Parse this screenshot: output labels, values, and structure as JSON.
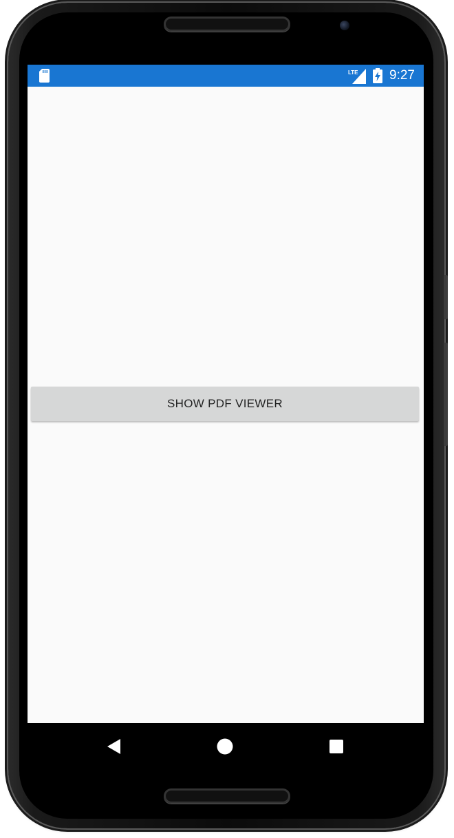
{
  "status_bar": {
    "time": "9:27",
    "network_label": "LTE",
    "icons": [
      "sd-card-icon",
      "lte-signal-icon",
      "battery-charging-icon"
    ],
    "background_color": "#1976d2"
  },
  "main": {
    "show_pdf_button_label": "SHOW PDF VIEWER"
  },
  "nav_bar": {
    "icons": [
      "back-icon",
      "home-icon",
      "recents-icon"
    ]
  }
}
